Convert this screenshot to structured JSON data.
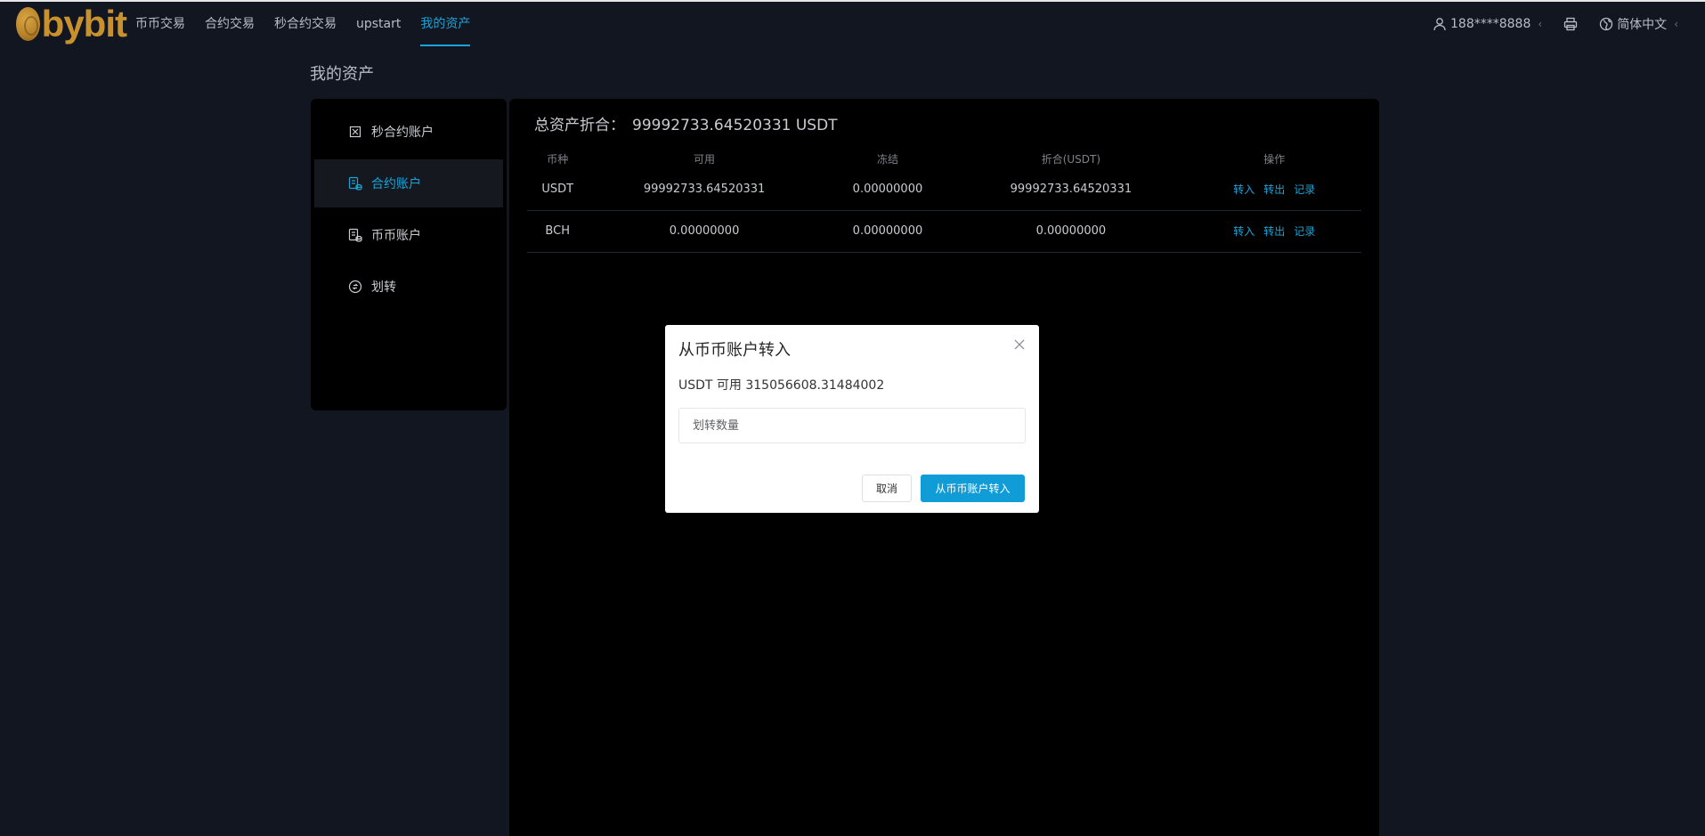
{
  "brand": {
    "logo_text": "bybit",
    "accent": "#1aa3d8",
    "logo_color": "#c8912e"
  },
  "nav": {
    "items": [
      {
        "label": "币币交易"
      },
      {
        "label": "合约交易"
      },
      {
        "label": "秒合约交易"
      },
      {
        "label": "upstart"
      },
      {
        "label": "我的资产"
      }
    ],
    "active_index": 4,
    "user": "188****8888",
    "language": "简体中文",
    "icons": [
      "user-icon",
      "print-icon",
      "globe-icon"
    ]
  },
  "page": {
    "title": "我的资产"
  },
  "sidebar": {
    "items": [
      {
        "label": "秒合约账户",
        "icon": "second-contract-icon"
      },
      {
        "label": "合约账户",
        "icon": "contract-wallet-icon"
      },
      {
        "label": "币币账户",
        "icon": "spot-wallet-icon"
      },
      {
        "label": "划转",
        "icon": "transfer-icon"
      }
    ],
    "active_index": 1
  },
  "main": {
    "total_label": "总资产折合：",
    "total_value": "99992733.64520331 USDT",
    "table": {
      "headers": [
        "币种",
        "可用",
        "冻结",
        "折合(USDT)",
        "操作"
      ],
      "rows": [
        {
          "coin": "USDT",
          "available": "99992733.64520331",
          "frozen": "0.00000000",
          "equiv": "99992733.64520331"
        },
        {
          "coin": "BCH",
          "available": "0.00000000",
          "frozen": "0.00000000",
          "equiv": "0.00000000"
        }
      ],
      "ops": [
        "转入",
        "转出",
        "记录"
      ]
    }
  },
  "modal": {
    "title": "从币币账户转入",
    "available_text": "USDT 可用 315056608.31484002",
    "input_placeholder": "划转数量",
    "input_value": "",
    "cancel_label": "取消",
    "confirm_label": "从币币账户转入",
    "confirm_color": "#0f9cd7"
  }
}
